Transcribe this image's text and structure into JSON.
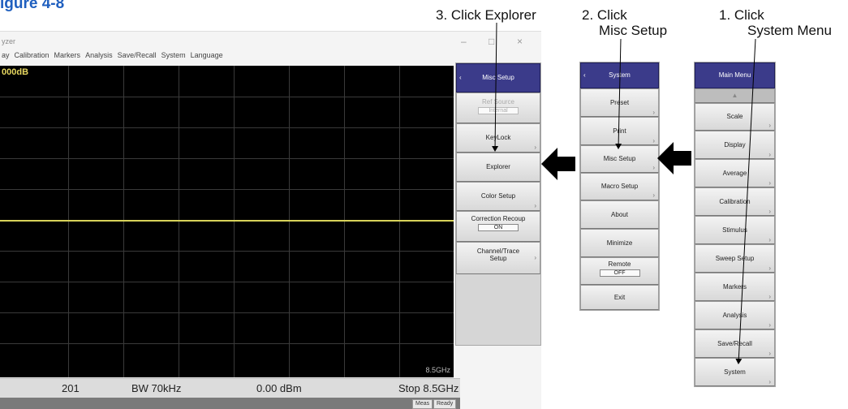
{
  "page_title": "igure 4-8",
  "steps": {
    "step1": {
      "line1": "1. Click",
      "line2": "System Menu"
    },
    "step2": {
      "line1": "2. Click",
      "line2": "Misc Setup"
    },
    "step3": {
      "line1": "3. Click Explorer"
    }
  },
  "app": {
    "title": "yzer",
    "window_controls": {
      "minimize": "–",
      "maximize": "□",
      "close": "×"
    },
    "menu": [
      "ay",
      "Calibration",
      "Markers",
      "Analysis",
      "Save/Recall",
      "System",
      "Language"
    ],
    "scale_readout": "000dB",
    "stop_freq_axis": "8.5GHz",
    "status": {
      "points": "201",
      "bw": "BW 70kHz",
      "power": "0.00 dBm",
      "stop": "Stop 8.5GHz"
    },
    "bottom_chips": {
      "meas": "Meas",
      "ready": "Ready"
    }
  },
  "panels": {
    "misc_setup": {
      "header": "Misc Setup",
      "back_icon": "back-chevron",
      "items": [
        {
          "label": "Ref Source",
          "value": "Internal",
          "disabled": true
        },
        {
          "label": "KeyLock"
        },
        {
          "label": "Explorer"
        },
        {
          "label": "Color Setup"
        },
        {
          "label": "Correction Recoup",
          "value": "ON"
        },
        {
          "label": "Channel/Trace",
          "label2": "Setup"
        }
      ]
    },
    "system": {
      "header": "System",
      "back_icon": "back-chevron",
      "items": [
        {
          "label": "Preset"
        },
        {
          "label": "Print"
        },
        {
          "label": "Misc Setup"
        },
        {
          "label": "Macro Setup"
        },
        {
          "label": "About"
        },
        {
          "label": "Minimize"
        },
        {
          "label": "Remote",
          "value": "OFF"
        },
        {
          "label": "Exit"
        }
      ]
    },
    "main_menu": {
      "header": "Main Menu",
      "up_icon": "▲",
      "items": [
        {
          "label": "Scale"
        },
        {
          "label": "Display"
        },
        {
          "label": "Average"
        },
        {
          "label": "Calibration"
        },
        {
          "label": "Stimulus"
        },
        {
          "label": "Sweep Setup"
        },
        {
          "label": "Markers"
        },
        {
          "label": "Analysis"
        },
        {
          "label": "Save/Recall"
        },
        {
          "label": "System"
        }
      ]
    }
  },
  "colors": {
    "title_blue": "#1f5fbf",
    "menu_header": "#3b3b8a",
    "trace": "#d8d35a"
  }
}
